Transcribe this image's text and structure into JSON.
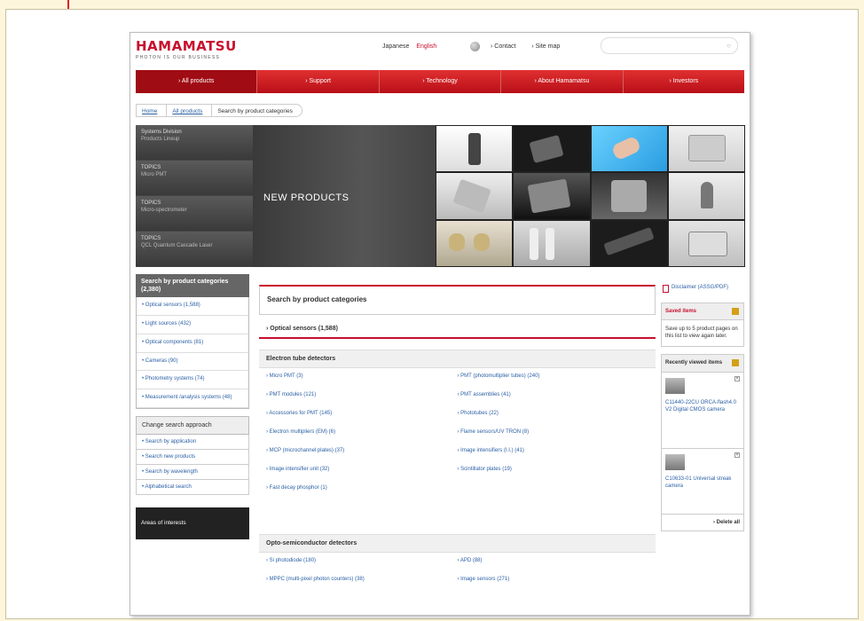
{
  "header": {
    "logo_name": "HAMAMATSU",
    "logo_tagline": "PHOTON IS OUR BUSINESS",
    "lang_japanese": "Japanese",
    "lang_english": "English",
    "contact": "Contact",
    "sitemap": "Site map",
    "search_icon": "search-icon"
  },
  "nav": {
    "items": [
      "All products",
      "Support",
      "Technology",
      "About Hamamatsu",
      "Investors"
    ]
  },
  "breadcrumb": {
    "items": [
      "Home",
      "All products",
      "Search by product categories"
    ]
  },
  "banner": {
    "tabs": [
      {
        "line1": "Systems Division",
        "line2": "Products Lineup"
      },
      {
        "line1": "TOPICS",
        "line2": "Micro PMT"
      },
      {
        "line1": "TOPICS",
        "line2": "Micro-spectrometer"
      },
      {
        "line1": "TOPICS",
        "line2": "QCL Quantum Cascade Laser"
      }
    ],
    "hero_title": "NEW PRODUCTS"
  },
  "sidebar": {
    "heading": "Search by product categories (2,380)",
    "items": [
      "Optical sensors (1,588)",
      "Light sources (432)",
      "Optical components (81)",
      "Cameras (90)",
      "Photometry systems (74)",
      "Measurement /analysis systems (48)"
    ],
    "change_heading": "Change search approach",
    "change_links": [
      "Search by application",
      "Search new products",
      "Search by wavelength",
      "Alphabetical search"
    ],
    "areas": "Areas of interests"
  },
  "main": {
    "title": "Search by product categories",
    "optical_label": "Optical sensors (1,588)",
    "section1_title": "Electron tube detectors",
    "section1_left": [
      "Micro PMT (3)",
      "PMT modules (121)",
      "Accessories for PMT (145)",
      "Electron multipliers (EM) (6)",
      "MCP (microchannel plates) (37)",
      "Image intensifier unit (32)",
      "Fast decay phosphor (1)"
    ],
    "section1_right": [
      "PMT (photomultiplier tubes) (240)",
      "PMT assemblies (41)",
      "Phototubes (22)",
      "Flame sensors/UV TRON (8)",
      "Image intensifiers (I.I.) (41)",
      "Scintillator plates (19)"
    ],
    "section2_title": "Opto-semiconductor detectors",
    "section2_left": [
      "Si photodiode (180)",
      "MPPC (multi-pixel photon counters) (38)"
    ],
    "section2_right": [
      "APD (88)",
      "Image sensors (271)"
    ]
  },
  "right": {
    "disclaimer": "Disclaimer (ASSG/PDF)",
    "saved_title": "Saved items",
    "saved_body": "Save up to 5 product pages on this list to view again later.",
    "recent_title": "Recently viewed items",
    "recent_items": [
      "C11440-22CU ORCA-flash4.0 V2 Digital CMOS camera",
      "C10633-01 Universal streak camera"
    ],
    "delete_all": "Delete all"
  },
  "colors": {
    "brand": "#c8102e",
    "link": "#2a5fa5",
    "callout": "#e02020"
  }
}
